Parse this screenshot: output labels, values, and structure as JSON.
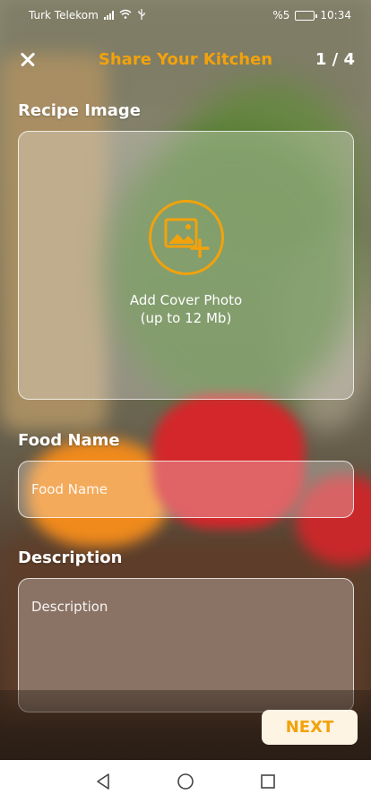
{
  "status_bar": {
    "carrier": "Turk Telekom",
    "battery_percent": "%5",
    "time": "10:34"
  },
  "header": {
    "title": "Share Your Kitchen",
    "step": "1 / 4"
  },
  "recipe_image": {
    "label": "Recipe Image",
    "upload_line1": "Add Cover Photo",
    "upload_line2": "(up to 12 Mb)"
  },
  "food_name": {
    "label": "Food Name",
    "placeholder": "Food Name"
  },
  "description": {
    "label": "Description",
    "placeholder": "Description"
  },
  "actions": {
    "next_label": "NEXT"
  },
  "colors": {
    "accent": "#f2a20c",
    "next_button_bg": "#fdf4e3"
  }
}
